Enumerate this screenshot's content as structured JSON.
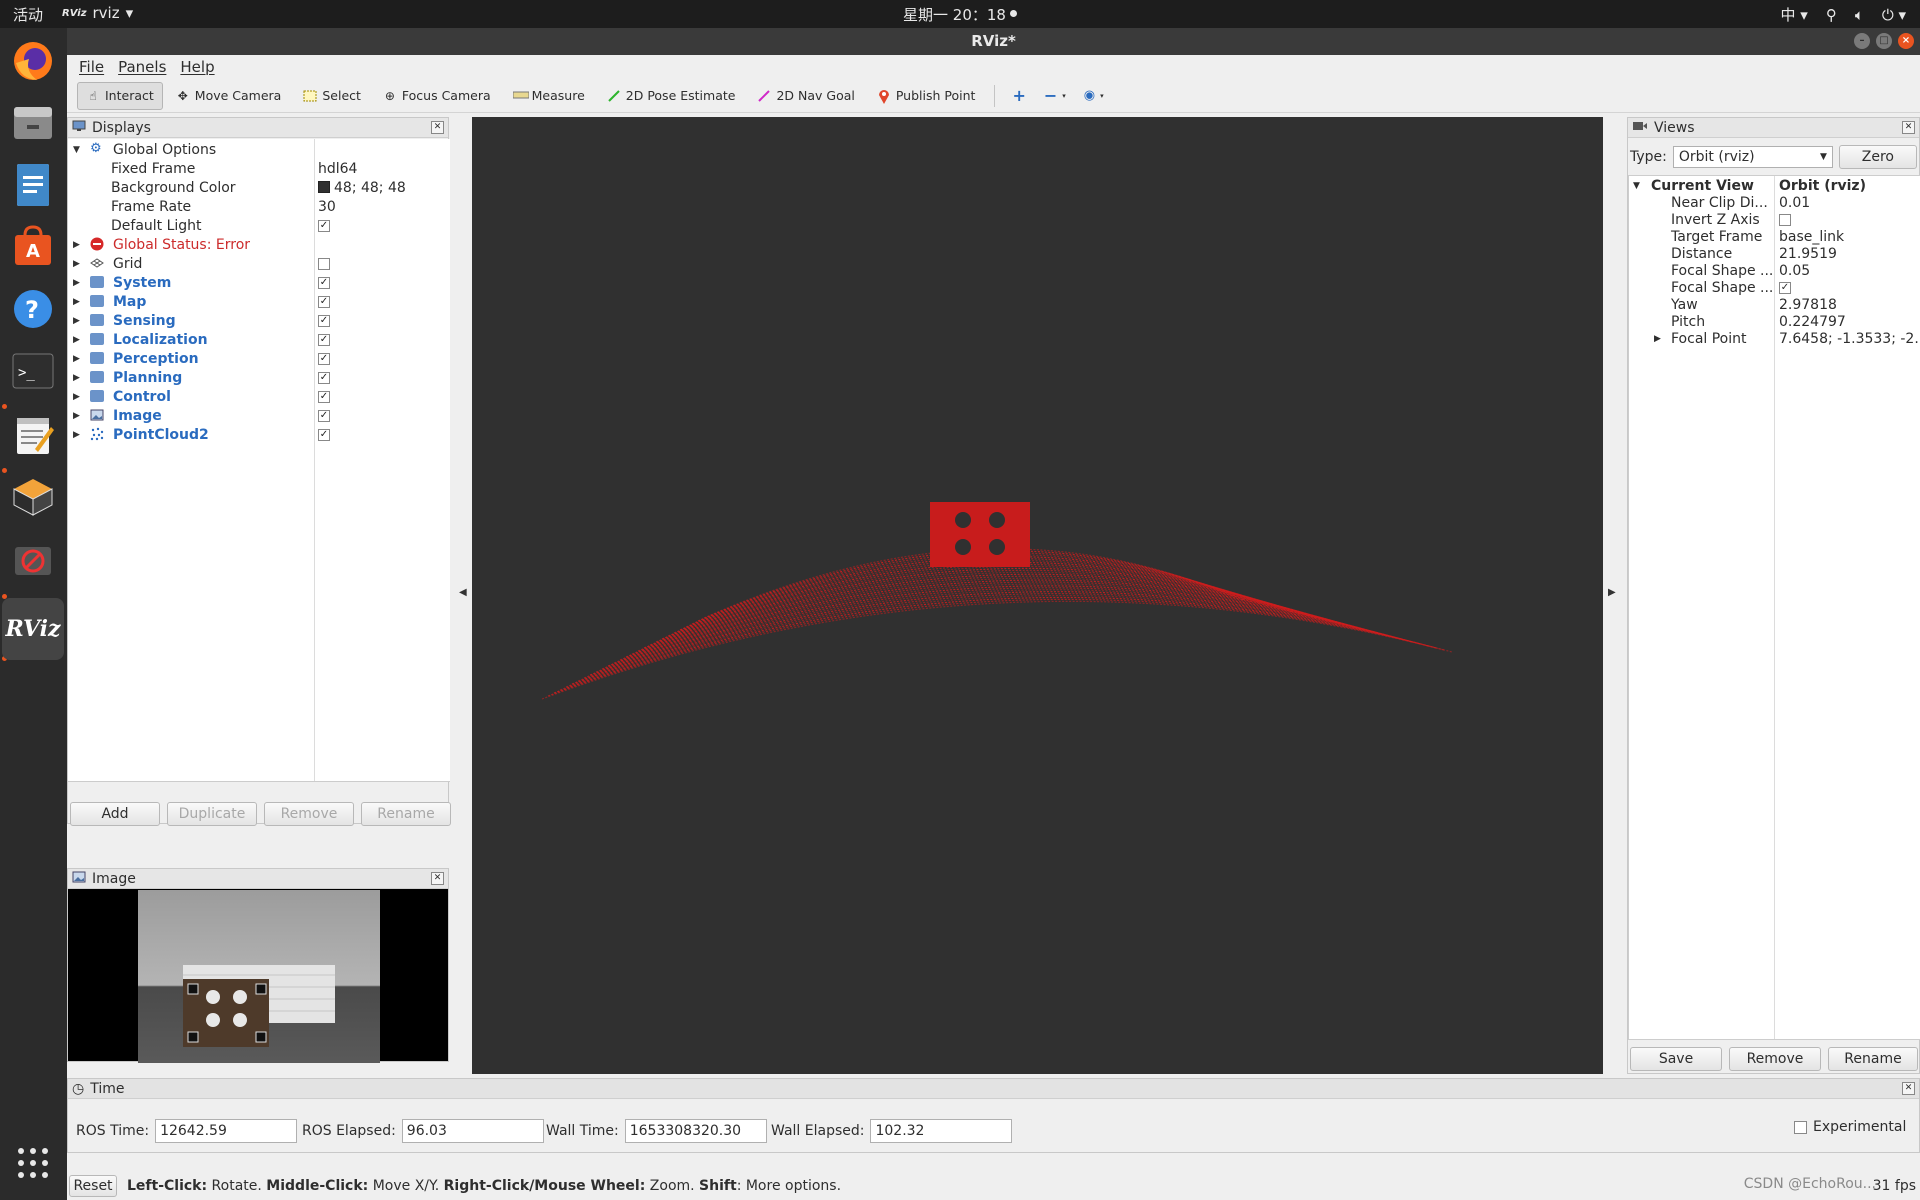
{
  "topbar": {
    "activities": "活动",
    "app_name": "rviz",
    "app_logo": "RViz",
    "clock": "星期一 20：18",
    "input_method": "中",
    "icons": [
      "chevron-down-icon",
      "accessibility-icon",
      "volume-icon",
      "power-icon"
    ]
  },
  "dock": {
    "apps": [
      "firefox-icon",
      "files-icon",
      "writer-icon",
      "software-store-icon",
      "help-icon",
      "terminal-icon",
      "text-editor-icon",
      "virtualbox-icon",
      "blocked-app-icon",
      "rviz-icon",
      "app-grid-icon"
    ],
    "rviz_label": "RViz"
  },
  "window": {
    "title": "RViz*",
    "controls": [
      "–",
      "□",
      "×"
    ]
  },
  "menu": [
    "File",
    "Panels",
    "Help"
  ],
  "toolbar": {
    "tools": [
      {
        "label": "Interact",
        "icon": "cursor-icon",
        "active": true
      },
      {
        "label": "Move Camera",
        "icon": "move-icon",
        "active": false
      },
      {
        "label": "Select",
        "icon": "select-box-icon",
        "active": false
      },
      {
        "label": "Focus Camera",
        "icon": "focus-icon",
        "active": false
      },
      {
        "label": "Measure",
        "icon": "ruler-icon",
        "active": false
      },
      {
        "label": "2D Pose Estimate",
        "icon": "green-arrow-icon",
        "active": false
      },
      {
        "label": "2D Nav Goal",
        "icon": "pink-arrow-icon",
        "active": false
      },
      {
        "label": "Publish Point",
        "icon": "pin-icon",
        "active": false
      }
    ],
    "extra_icons": [
      "plus-icon",
      "minus-icon",
      "eye-icon"
    ]
  },
  "displays": {
    "title": "Displays",
    "global_options": {
      "label": "Global Options",
      "fixed_frame_label": "Fixed Frame",
      "fixed_frame": "hdl64",
      "bg_color_label": "Background Color",
      "bg_color": "48; 48; 48",
      "frame_rate_label": "Frame Rate",
      "frame_rate": "30",
      "default_light_label": "Default Light",
      "default_light": true
    },
    "global_status": "Global Status: Error",
    "items": [
      {
        "label": "Grid",
        "checked": false,
        "group": false
      },
      {
        "label": "System",
        "checked": true,
        "group": true
      },
      {
        "label": "Map",
        "checked": true,
        "group": true
      },
      {
        "label": "Sensing",
        "checked": true,
        "group": true
      },
      {
        "label": "Localization",
        "checked": true,
        "group": true
      },
      {
        "label": "Perception",
        "checked": true,
        "group": true
      },
      {
        "label": "Planning",
        "checked": true,
        "group": true
      },
      {
        "label": "Control",
        "checked": true,
        "group": true
      },
      {
        "label": "Image",
        "checked": true,
        "group": true
      },
      {
        "label": "PointCloud2",
        "checked": true,
        "group": true
      }
    ],
    "buttons": {
      "add": "Add",
      "duplicate": "Duplicate",
      "remove": "Remove",
      "rename": "Rename"
    }
  },
  "image_panel": {
    "title": "Image"
  },
  "views": {
    "title": "Views",
    "type_label": "Type:",
    "type_value": "Orbit (rviz)",
    "zero": "Zero",
    "current_view_label": "Current View",
    "current_view_value": "Orbit (rviz)",
    "props": [
      {
        "label": "Near Clip Di...",
        "value": "0.01"
      },
      {
        "label": "Invert Z Axis",
        "value": "",
        "checkbox": false
      },
      {
        "label": "Target Frame",
        "value": "base_link"
      },
      {
        "label": "Distance",
        "value": "21.9519"
      },
      {
        "label": "Focal Shape ...",
        "value": "0.05"
      },
      {
        "label": "Focal Shape ...",
        "value": "",
        "checkbox": true
      },
      {
        "label": "Yaw",
        "value": "2.97818"
      },
      {
        "label": "Pitch",
        "value": "0.224797"
      },
      {
        "label": "Focal Point",
        "value": "7.6458; -1.3533; -2..."
      }
    ],
    "buttons": {
      "save": "Save",
      "remove": "Remove",
      "rename": "Rename"
    }
  },
  "time": {
    "title": "Time",
    "ros_time_label": "ROS Time:",
    "ros_time": "12642.59",
    "ros_elapsed_label": "ROS Elapsed:",
    "ros_elapsed": "96.03",
    "wall_time_label": "Wall Time:",
    "wall_time": "1653308320.30",
    "wall_elapsed_label": "Wall Elapsed:",
    "wall_elapsed": "102.32",
    "experimental_label": "Experimental"
  },
  "status": {
    "reset": "Reset",
    "left_click": "Left-Click:",
    "left_click_desc": "Rotate.",
    "middle_click": "Middle-Click:",
    "middle_click_desc": "Move X/Y.",
    "right_click": "Right-Click/Mouse Wheel:",
    "right_click_desc": "Zoom.",
    "shift": "Shift",
    "shift_desc": ": More options.",
    "fps": "31 fps"
  },
  "watermark": "CSDN @EchoRou...",
  "colors": {
    "pointcloud": "#d11d1d",
    "viewport_bg": "#303030",
    "error": "#cc2b2b",
    "group_label": "#2a6bbf"
  }
}
